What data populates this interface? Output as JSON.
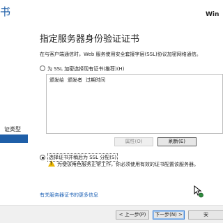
{
  "window": {
    "title_fragment": "书",
    "os_label": "Win"
  },
  "sidebar": {
    "item_label": "证类型"
  },
  "page": {
    "heading": "指定服务器身份验证证书",
    "description": "在与客户端通信时，Web 服务使用安全套接字层(SSL)协议加密网络通信。"
  },
  "options": {
    "existing_label": "为 SSL 加密选择现有证书(推荐)(H)",
    "existing_selected": false,
    "self_signed_label": "选择证书并稍后为 SSL 分配(S)",
    "self_signed_selected": true
  },
  "cert_table": {
    "columns": [
      "颁发给",
      "颁发者",
      "过期时间"
    ],
    "rows": []
  },
  "buttons": {
    "properties": "属性(O)",
    "refresh": "刷新(E)",
    "previous": "< 上一步(P)",
    "next": "下一步(N) >",
    "install": "安"
  },
  "warning": {
    "text": "为使该角色服务正常工作，你必须使用有效的证书配置该服务器。",
    "icon": "warning-triangle-icon",
    "color": "#e8b400"
  },
  "links": {
    "more_info": "有关服务器证书的更多信息"
  },
  "colors": {
    "accent": "#1f5fa8",
    "link": "#1a5fb4"
  }
}
